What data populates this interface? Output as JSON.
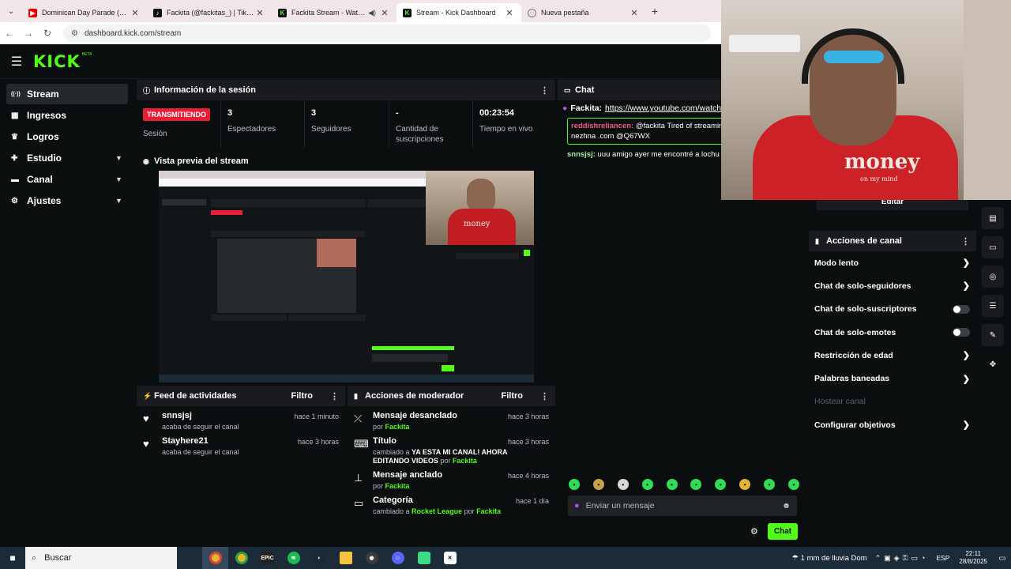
{
  "browser": {
    "tabs": [
      {
        "title": "Dominican Day Parade (Recap",
        "fav": "yt",
        "active": false,
        "audio": false
      },
      {
        "title": "Fackita (@fackitas_) | TikTok",
        "fav": "tt",
        "active": false,
        "audio": false
      },
      {
        "title": "Fackita Stream - Watch Live",
        "fav": "kick",
        "active": false,
        "audio": true
      },
      {
        "title": "Stream - Kick Dashboard",
        "fav": "kick",
        "active": true,
        "audio": false
      },
      {
        "title": "Nueva pestaña",
        "fav": "new",
        "active": false,
        "audio": false
      }
    ],
    "url": "dashboard.kick.com/stream"
  },
  "app": {
    "logo": "KICK",
    "beta": "BETA"
  },
  "sidebar": {
    "items": [
      {
        "label": "Stream",
        "icon": "signal-icon",
        "active": true,
        "expandable": false
      },
      {
        "label": "Ingresos",
        "icon": "money-icon",
        "active": false,
        "expandable": false
      },
      {
        "label": "Logros",
        "icon": "trophy-icon",
        "active": false,
        "expandable": false
      },
      {
        "label": "Estudio",
        "icon": "studio-icon",
        "active": false,
        "expandable": true
      },
      {
        "label": "Canal",
        "icon": "channel-icon",
        "active": false,
        "expandable": true
      },
      {
        "label": "Ajustes",
        "icon": "gear-icon",
        "active": false,
        "expandable": true
      }
    ]
  },
  "session": {
    "title": "Información de la sesión",
    "badge": "TRANSMITIENDO",
    "badge_label": "Sesión",
    "stats": [
      {
        "value": "3",
        "label": "Espectadores"
      },
      {
        "value": "3",
        "label": "Seguidores"
      },
      {
        "value": "-",
        "label": "Cantidad de suscripciones"
      },
      {
        "value": "00:23:54",
        "label": "Tiempo en vivo"
      }
    ]
  },
  "preview": {
    "title": "Vista previa del stream"
  },
  "feed": {
    "title": "Feed de actividades",
    "filter": "Filtro",
    "items": [
      {
        "user": "snnsjsj",
        "action": "acaba de seguir el canal",
        "time": "hace 1 minuto"
      },
      {
        "user": "Stayhere21",
        "action": "acaba de seguir el canal",
        "time": "hace 3 horas"
      }
    ]
  },
  "modactions": {
    "title": "Acciones de moderador",
    "filter": "Filtro",
    "items": [
      {
        "title": "Mensaje desanclado",
        "pre": "por",
        "value": "",
        "by_pre": "",
        "by": "Fackita",
        "time": "hace 3 horas"
      },
      {
        "title": "Título",
        "pre": "cambiado a",
        "value": "YA ESTA MI CANAL! AHORA EDITANDO VIDEOS",
        "by_pre": "por",
        "by": "Fackita",
        "time": "hace 3 horas"
      },
      {
        "title": "Mensaje anclado",
        "pre": "por",
        "value": "",
        "by_pre": "",
        "by": "Fackita",
        "time": "hace 4 horas"
      },
      {
        "title": "Categoría",
        "pre": "cambiado a",
        "value": "Rocket League",
        "by_pre": "por",
        "by": "Fackita",
        "time": "hace 1 día"
      }
    ]
  },
  "chat": {
    "title": "Chat",
    "pinned_user": "Fackita:",
    "pinned_link": "https://www.youtube.com/watch?v",
    "messages": [
      {
        "user": "reddishreliancen:",
        "text": "@fackita Tired of streaming t that — only at nezhna .com @Q67WX",
        "boxed": true
      },
      {
        "user": "snnsjsj:",
        "text": "uuu amigo ayer me encontré a lochu po",
        "boxed": false
      }
    ],
    "input_placeholder": "Enviar un mensaje",
    "send_label": "Chat"
  },
  "channel_actions": {
    "edit_label": "Editar",
    "title": "Acciones de canal",
    "options": [
      {
        "label": "Modo lento",
        "control": "chevron"
      },
      {
        "label": "Chat de solo-seguidores",
        "control": "chevron"
      },
      {
        "label": "Chat de solo-suscriptores",
        "control": "toggle"
      },
      {
        "label": "Chat de solo-emotes",
        "control": "toggle"
      },
      {
        "label": "Restricción de edad",
        "control": "chevron"
      },
      {
        "label": "Palabras baneadas",
        "control": "chevron"
      },
      {
        "label": "Hostear canal",
        "control": "none"
      },
      {
        "label": "Configurar objetivos",
        "control": "chevron"
      }
    ]
  },
  "webcam": {
    "shirt_text": "money",
    "shirt_sub": "on my mind"
  },
  "taskbar": {
    "search_placeholder": "Buscar",
    "weather": "1 mm de lluvia Dom",
    "lang": "ESP",
    "time": "22:11",
    "date": "28/8/2025"
  }
}
